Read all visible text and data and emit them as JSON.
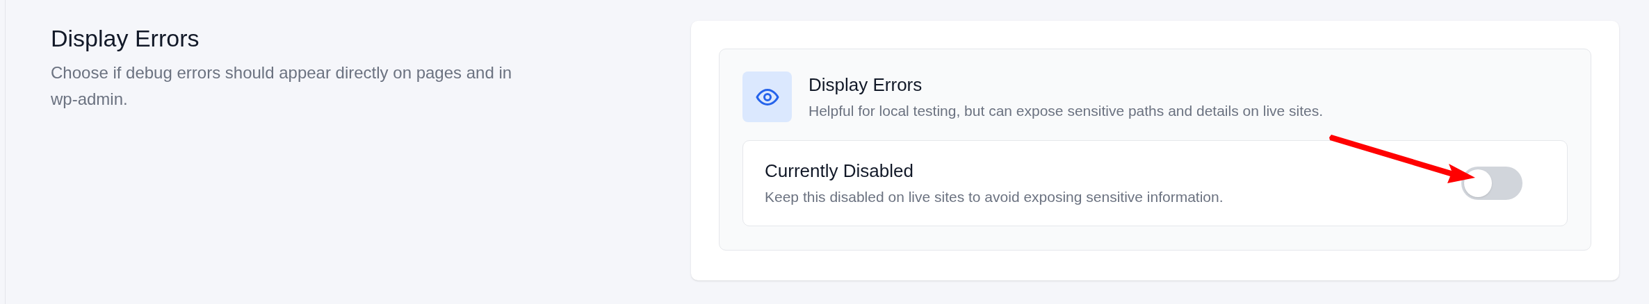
{
  "section": {
    "title": "Display Errors",
    "description": "Choose if debug errors should appear directly on pages and in wp-admin."
  },
  "setting": {
    "title": "Display Errors",
    "description": "Helpful for local testing, but can expose sensitive paths and details on live sites.",
    "status_title": "Currently Disabled",
    "status_description": "Keep this disabled on live sites to avoid exposing sensitive information.",
    "on": false
  }
}
